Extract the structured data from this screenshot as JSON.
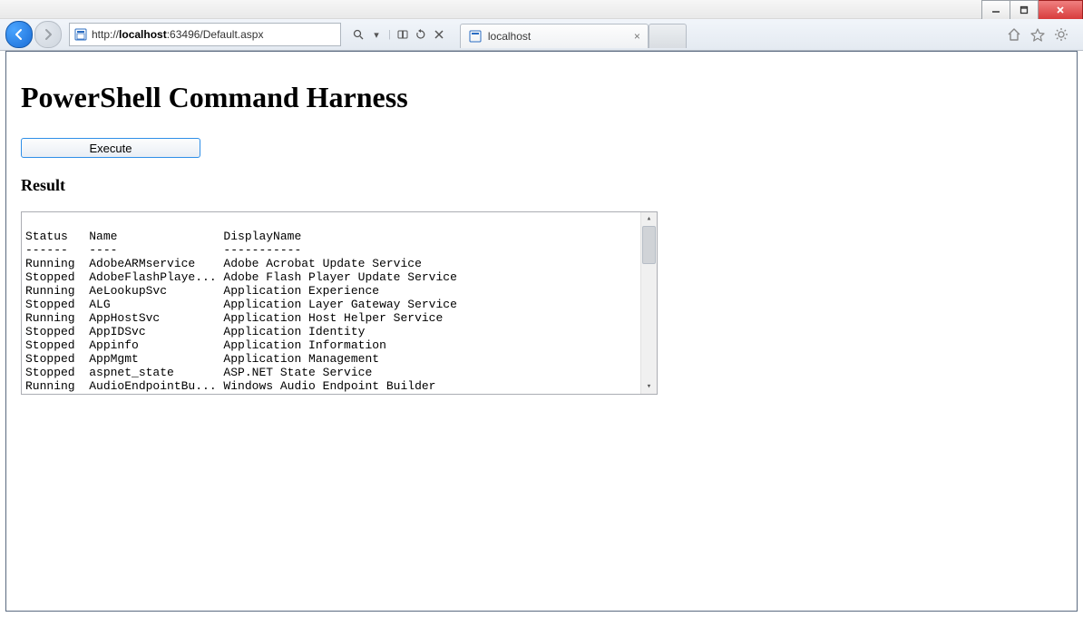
{
  "titlebar": {
    "minimize": "—",
    "maximize": "☐",
    "close": "✕"
  },
  "navbar": {
    "url_prefix": "http://",
    "url_host": "localhost",
    "url_rest": ":63496/Default.aspx",
    "search_glyph": "🔍",
    "compat_glyph": "↻",
    "stop_glyph": "✕",
    "dropdown_glyph": "▾"
  },
  "tab": {
    "favicon": "▦",
    "title": "localhost",
    "close": "×"
  },
  "rightIcons": {
    "home": "⌂",
    "star": "☆",
    "gear": "⚙"
  },
  "page": {
    "heading": "PowerShell Command Harness",
    "execute_label": "Execute",
    "result_label": "Result"
  },
  "result": {
    "headers": [
      "Status",
      "Name",
      "DisplayName"
    ],
    "separators": [
      "------",
      "----",
      "-----------"
    ],
    "rows": [
      {
        "status": "Running",
        "name": "AdobeARMservice",
        "display": "Adobe Acrobat Update Service"
      },
      {
        "status": "Stopped",
        "name": "AdobeFlashPlaye...",
        "display": "Adobe Flash Player Update Service"
      },
      {
        "status": "Running",
        "name": "AeLookupSvc",
        "display": "Application Experience"
      },
      {
        "status": "Stopped",
        "name": "ALG",
        "display": "Application Layer Gateway Service"
      },
      {
        "status": "Running",
        "name": "AppHostSvc",
        "display": "Application Host Helper Service"
      },
      {
        "status": "Stopped",
        "name": "AppIDSvc",
        "display": "Application Identity"
      },
      {
        "status": "Stopped",
        "name": "Appinfo",
        "display": "Application Information"
      },
      {
        "status": "Stopped",
        "name": "AppMgmt",
        "display": "Application Management"
      },
      {
        "status": "Stopped",
        "name": "aspnet_state",
        "display": "ASP.NET State Service"
      },
      {
        "status": "Running",
        "name": "AudioEndpointBu...",
        "display": "Windows Audio Endpoint Builder"
      }
    ]
  }
}
